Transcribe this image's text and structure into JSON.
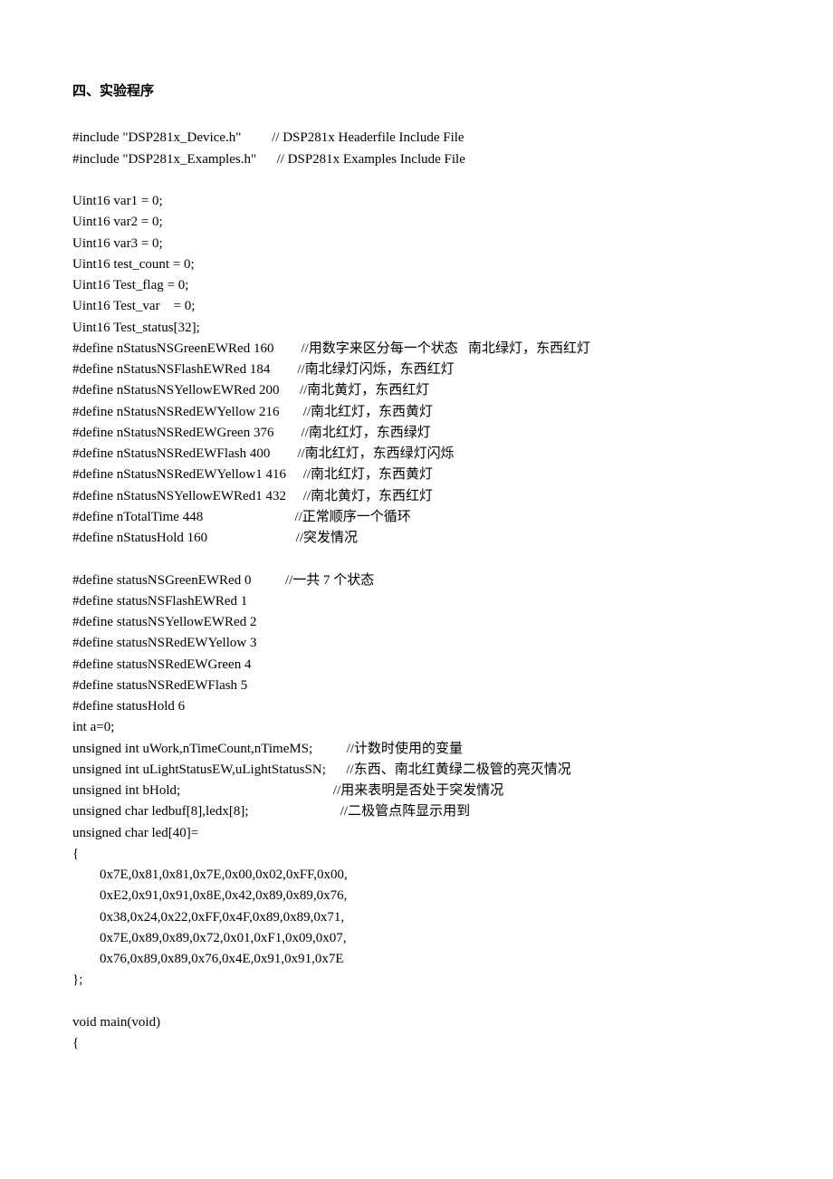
{
  "heading": "四、实验程序",
  "lines": [
    "#include \"DSP281x_Device.h\"         // DSP281x Headerfile Include File",
    "#include \"DSP281x_Examples.h\"      // DSP281x Examples Include File",
    "",
    "Uint16 var1 = 0;",
    "Uint16 var2 = 0;",
    "Uint16 var3 = 0;",
    "Uint16 test_count = 0;",
    "Uint16 Test_flag = 0;",
    "Uint16 Test_var    = 0;",
    "Uint16 Test_status[32];",
    "#define nStatusNSGreenEWRed 160        //用数字来区分每一个状态   南北绿灯，东西红灯",
    "#define nStatusNSFlashEWRed 184        //南北绿灯闪烁，东西红灯",
    "#define nStatusNSYellowEWRed 200      //南北黄灯，东西红灯",
    "#define nStatusNSRedEWYellow 216       //南北红灯，东西黄灯",
    "#define nStatusNSRedEWGreen 376        //南北红灯，东西绿灯",
    "#define nStatusNSRedEWFlash 400        //南北红灯，东西绿灯闪烁",
    "#define nStatusNSRedEWYellow1 416     //南北红灯，东西黄灯",
    "#define nStatusNSYellowEWRed1 432     //南北黄灯，东西红灯",
    "#define nTotalTime 448                           //正常顺序一个循环",
    "#define nStatusHold 160                          //突发情况",
    "",
    "#define statusNSGreenEWRed 0          //一共 7 个状态",
    "#define statusNSFlashEWRed 1",
    "#define statusNSYellowEWRed 2",
    "#define statusNSRedEWYellow 3",
    "#define statusNSRedEWGreen 4",
    "#define statusNSRedEWFlash 5",
    "#define statusHold 6",
    "int a=0;",
    "unsigned int uWork,nTimeCount,nTimeMS;          //计数时使用的变量",
    "unsigned int uLightStatusEW,uLightStatusSN;      //东西、南北红黄绿二极管的亮灭情况",
    "unsigned int bHold;                                             //用来表明是否处于突发情况",
    "unsigned char ledbuf[8],ledx[8];                           //二极管点阵显示用到",
    "unsigned char led[40]=",
    "{",
    "        0x7E,0x81,0x81,0x7E,0x00,0x02,0xFF,0x00,",
    "        0xE2,0x91,0x91,0x8E,0x42,0x89,0x89,0x76,",
    "        0x38,0x24,0x22,0xFF,0x4F,0x89,0x89,0x71,",
    "        0x7E,0x89,0x89,0x72,0x01,0xF1,0x09,0x07,",
    "        0x76,0x89,0x89,0x76,0x4E,0x91,0x91,0x7E",
    "};",
    "",
    "void main(void)",
    "{"
  ]
}
